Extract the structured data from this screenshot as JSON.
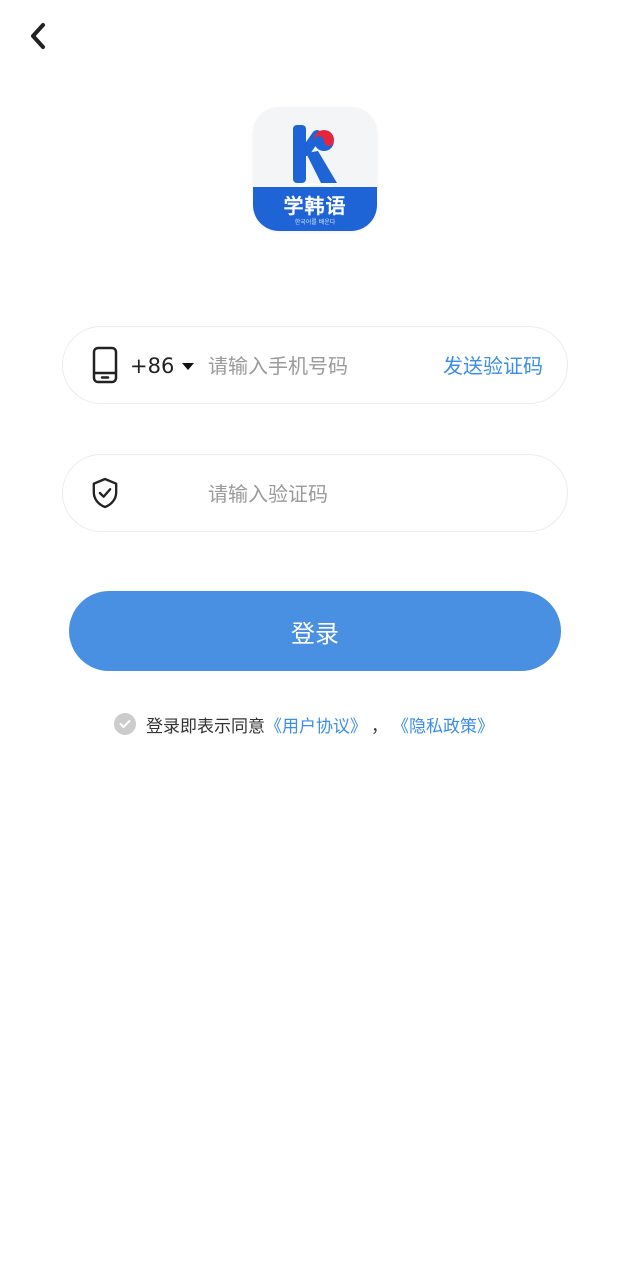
{
  "header": {
    "back_icon": "chevron-left-icon"
  },
  "logo": {
    "title": "学韩语",
    "subtitle": "한국어를 배운다",
    "brand_color": "#1f64d6",
    "accent_color": "#e5253a"
  },
  "phone_field": {
    "icon": "phone-icon",
    "country_code": "+86",
    "placeholder": "请输入手机号码",
    "value": "",
    "send_code_label": "发送验证码"
  },
  "code_field": {
    "icon": "shield-check-icon",
    "placeholder": "请输入验证码",
    "value": ""
  },
  "login_button": {
    "label": "登录",
    "color": "#4a90e2"
  },
  "agreement": {
    "prefix": "登录即表示同意",
    "user_agreement": "《用户协议》",
    "separator": "，",
    "privacy_policy": "《隐私政策》",
    "link_color": "#3a8ee6",
    "checked": false
  }
}
